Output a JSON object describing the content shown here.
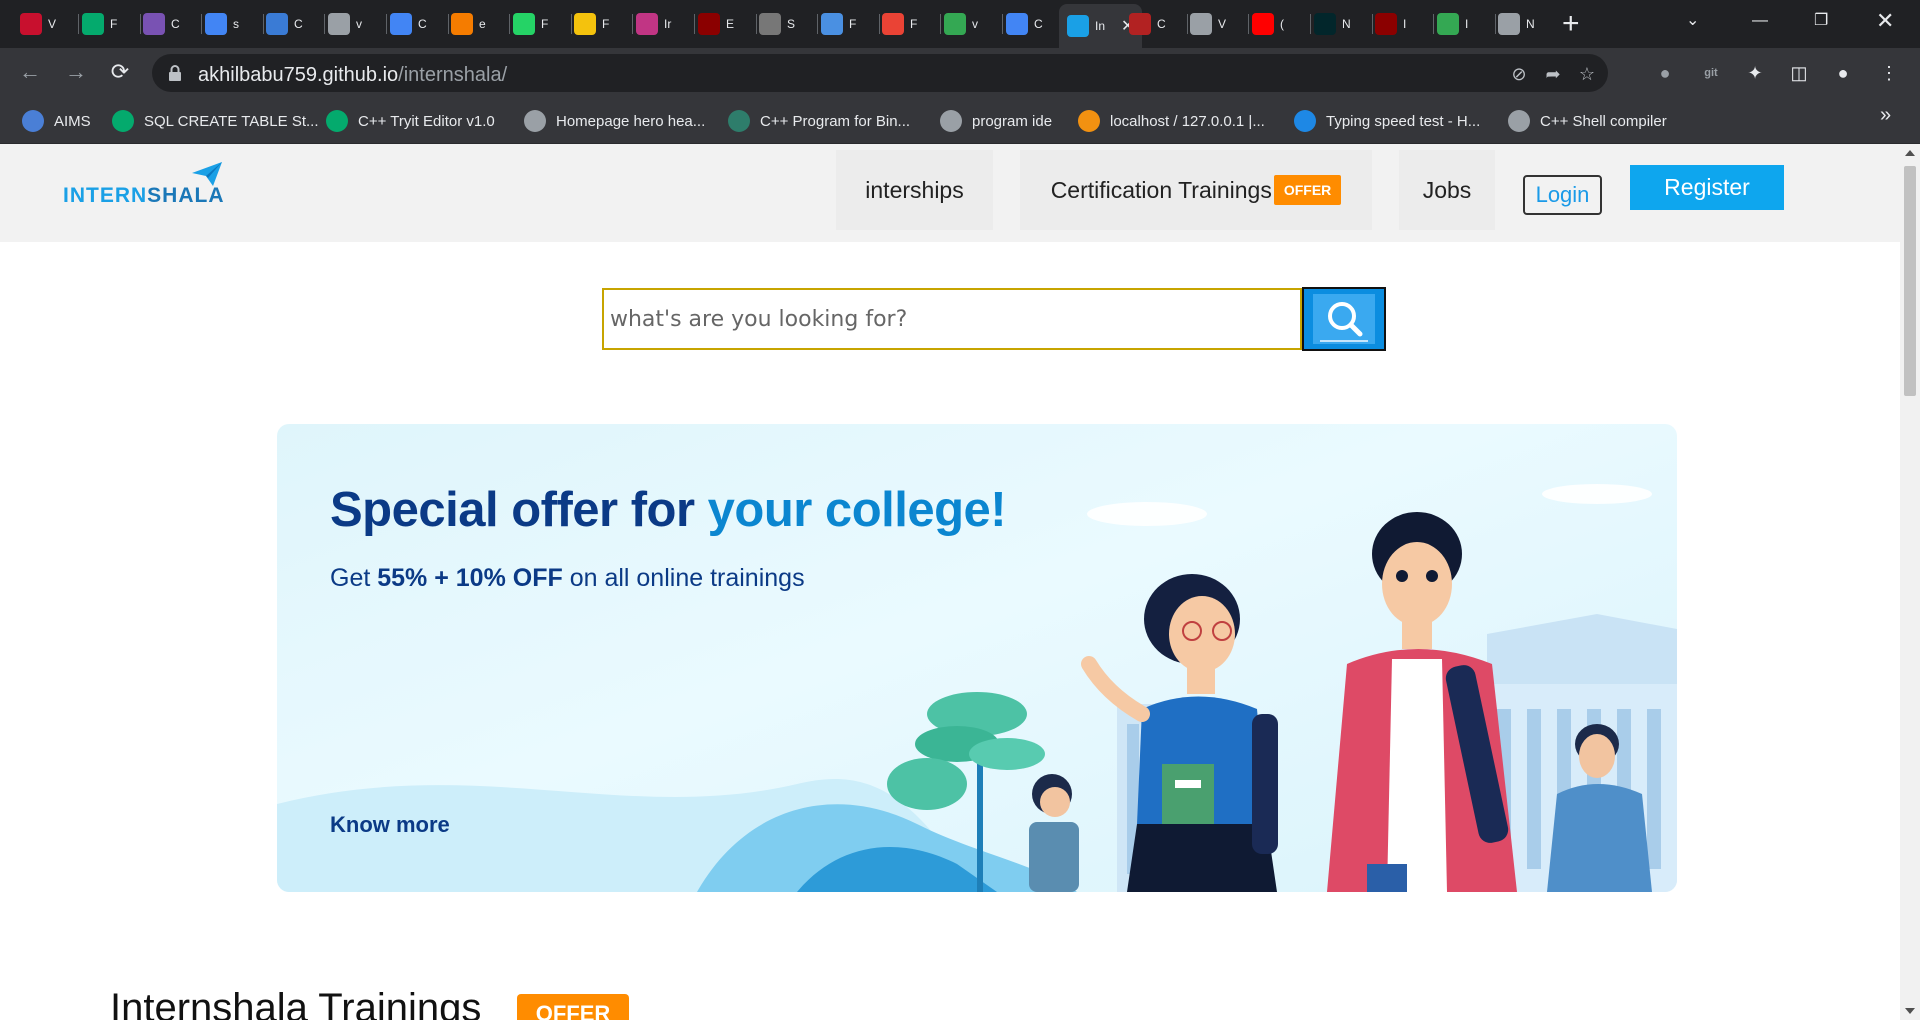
{
  "browser": {
    "tabs": [
      {
        "title": "V",
        "icon": "vi-icon",
        "color": "#c8102e"
      },
      {
        "title": "F",
        "icon": "w3-icon",
        "color": "#04aa6d"
      },
      {
        "title": "C",
        "icon": "bootstrap-icon",
        "color": "#7952b3"
      },
      {
        "title": "s",
        "icon": "google-icon",
        "color": "#4285f4"
      },
      {
        "title": "C",
        "icon": "infinity-icon",
        "color": "#3a7bd5"
      },
      {
        "title": "v",
        "icon": "globe-icon",
        "color": "#9aa0a6"
      },
      {
        "title": "C",
        "icon": "translate-icon",
        "color": "#4285f4"
      },
      {
        "title": "e",
        "icon": "fire-icon",
        "color": "#f57c00"
      },
      {
        "title": "F",
        "icon": "whatsapp-icon",
        "color": "#25d366"
      },
      {
        "title": "F",
        "icon": "spark-icon",
        "color": "#f4c20d"
      },
      {
        "title": "Ir",
        "icon": "instagram-icon",
        "color": "#c13584"
      },
      {
        "title": "E",
        "icon": "crest-icon",
        "color": "#8b0000"
      },
      {
        "title": "S",
        "icon": "emblem-icon",
        "color": "#777777"
      },
      {
        "title": "F",
        "icon": "person-icon",
        "color": "#4a90e2"
      },
      {
        "title": "F",
        "icon": "pinwheel-icon",
        "color": "#ea4335"
      },
      {
        "title": "v",
        "icon": "drive-icon",
        "color": "#34a853"
      },
      {
        "title": "C",
        "icon": "docs-icon",
        "color": "#4285f4"
      },
      {
        "title": "In",
        "icon": "internshala-icon",
        "color": "#1aa0e6",
        "active": true
      },
      {
        "title": "C",
        "icon": "crest-icon",
        "color": "#b22222"
      },
      {
        "title": "V",
        "icon": "globe-icon",
        "color": "#9aa0a6"
      },
      {
        "title": "(",
        "icon": "youtube-icon",
        "color": "#ff0000"
      },
      {
        "title": "N",
        "icon": "edx-icon",
        "color": "#02262b"
      },
      {
        "title": "I",
        "icon": "crest-icon",
        "color": "#8b0000"
      },
      {
        "title": "I",
        "icon": "maps-icon",
        "color": "#34a853"
      },
      {
        "title": "N",
        "icon": "chrome-icon",
        "color": "#9aa0a6"
      }
    ],
    "url_host": "akhilbabu759.github.io",
    "url_path": "/internshala/",
    "bookmarks": [
      {
        "label": "AIMS",
        "icon": "aims-icon",
        "color": "#4a7fd6"
      },
      {
        "label": "SQL CREATE TABLE St...",
        "icon": "w3-icon",
        "color": "#04aa6d"
      },
      {
        "label": "C++ Tryit Editor v1.0",
        "icon": "w3-icon",
        "color": "#04aa6d"
      },
      {
        "label": "Homepage hero hea...",
        "icon": "globe-icon",
        "color": "#9aa0a6"
      },
      {
        "label": "C++ Program for Bin...",
        "icon": "page-icon",
        "color": "#2e7d6b"
      },
      {
        "label": "program ide",
        "icon": "globe-icon",
        "color": "#9aa0a6"
      },
      {
        "label": "localhost / 127.0.0.1 |...",
        "icon": "phpmyadmin-icon",
        "color": "#f29111"
      },
      {
        "label": "Typing speed test - H...",
        "icon": "keyboard-icon",
        "color": "#1e88e5"
      },
      {
        "label": "C++ Shell compiler",
        "icon": "globe-icon",
        "color": "#9aa0a6"
      }
    ]
  },
  "header": {
    "logo_part1": "INTERN",
    "logo_part2": "SHALA",
    "nav": {
      "internships": "interships",
      "trainings": "Certification Trainings",
      "trainings_badge": "OFFER",
      "jobs": "Jobs"
    },
    "login": "Login",
    "register": "Register"
  },
  "search": {
    "placeholder": "what's are you looking for?"
  },
  "banner": {
    "title_part1": "Special offer for ",
    "title_part2": "your college!",
    "sub_prefix": "Get ",
    "sub_bold": "55% + 10% OFF",
    "sub_suffix": " on all online trainings",
    "link": "Know more"
  },
  "section": {
    "title": "Internshala Trainings",
    "badge": "OFFER"
  },
  "colors": {
    "brand": "#1aa0e6",
    "register": "#0ea6ee",
    "offer": "#ff8c00",
    "banner_text": "#0b3a86",
    "banner_highlight": "#0b86d0"
  }
}
